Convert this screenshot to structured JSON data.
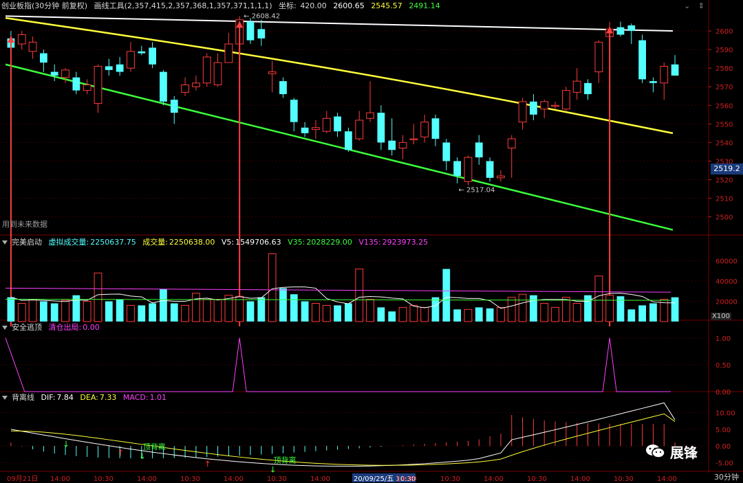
{
  "main_header": {
    "title": "创业板指(30分钟 前复权)",
    "tool": "画线工具(2,357,415,2,357,368,1,357,371,1,1,1)",
    "coord_label": "坐标:",
    "coord_value": "420.00",
    "value1": "2600.65",
    "value2": "2545.57",
    "value3": "2491.14"
  },
  "top_right_icons": [
    "chevron-down-icon",
    "up-down-icon"
  ],
  "future_label": "用到未来数据",
  "current_price": "2519.2",
  "high_label": "2608.42",
  "low_label": "2517.04",
  "volume_header": {
    "title": "完美启动",
    "v1_label": "虚拟成交量:",
    "v1_value": "2250637.75",
    "v2_label": "成交量:",
    "v2_value": "2250638.00",
    "v3_label": "V5:",
    "v3_value": "1549706.63",
    "v4_label": "V35:",
    "v4_value": "2028229.00",
    "v5_label": "V135:",
    "v5_value": "2923973.25"
  },
  "volume_multiplier": "X100",
  "safe_header": {
    "title": "安全逃顶",
    "v1_label": "清仓出局:",
    "v1_value": "0.00"
  },
  "macd_header": {
    "title": "背离线",
    "dif_label": "DIF:",
    "dif_value": "7.84",
    "dea_label": "DEA:",
    "dea_value": "7.33",
    "macd_label": "MACD:",
    "macd_value": "1.01"
  },
  "divergence_label": "顶背离",
  "timeframe": "30分钟",
  "watermark": "展锋",
  "colors": {
    "up": "#ff3c3c",
    "down": "#54ffff",
    "ma_white": "#ffffff",
    "ma_yellow": "#ffff3c",
    "ma_green": "#3cff3c",
    "magenta": "#ff40ff",
    "grid": "#7a0000",
    "axis_text": "#d02020"
  },
  "chart_data": [
    {
      "type": "candlestick",
      "title": "创业板指(30分钟 前复权)",
      "yticks": [
        2500,
        2510,
        2520,
        2530,
        2540,
        2550,
        2560,
        2570,
        2580,
        2590,
        2600
      ],
      "ylim": [
        2491,
        2610
      ],
      "x_ticks": [
        "09月21日",
        "14:00",
        "10:30",
        "14:00",
        "10:30",
        "14:00",
        "10:30",
        "14:00",
        "20/09/25/五 10:30",
        "14:00",
        "10:30",
        "14:00",
        "10:30",
        "14:00",
        "10:30",
        "14:00"
      ],
      "candles": [
        [
          2596,
          2591,
          2600,
          2588
        ],
        [
          2593,
          2598,
          2600,
          2590
        ],
        [
          2589,
          2594,
          2597,
          2585
        ],
        [
          2588,
          2583,
          2590,
          2578
        ],
        [
          2578,
          2576,
          2582,
          2573
        ],
        [
          2575,
          2579,
          2580,
          2572
        ],
        [
          2575,
          2568,
          2578,
          2566
        ],
        [
          2568,
          2571,
          2574,
          2566
        ],
        [
          2561,
          2581,
          2582,
          2556
        ],
        [
          2581,
          2579,
          2585,
          2576
        ],
        [
          2582,
          2578,
          2586,
          2576
        ],
        [
          2580,
          2589,
          2594,
          2578
        ],
        [
          2589,
          2588,
          2592,
          2587
        ],
        [
          2591,
          2582,
          2594,
          2580
        ],
        [
          2578,
          2562,
          2579,
          2560
        ],
        [
          2563,
          2556,
          2565,
          2550
        ],
        [
          2567,
          2571,
          2575,
          2565
        ],
        [
          2570,
          2572,
          2576,
          2568
        ],
        [
          2572,
          2586,
          2588,
          2570
        ],
        [
          2571,
          2583,
          2588,
          2570
        ],
        [
          2583,
          2593,
          2599,
          2583
        ],
        [
          2593,
          2606,
          2608,
          2592
        ],
        [
          2605,
          2595,
          2607,
          2593
        ],
        [
          2601,
          2596,
          2606,
          2592
        ],
        [
          2577,
          2578,
          2584,
          2567
        ],
        [
          2573,
          2566,
          2575,
          2564
        ],
        [
          2563,
          2551,
          2564,
          2546
        ],
        [
          2548,
          2545,
          2551,
          2543
        ],
        [
          2547,
          2548,
          2552,
          2542
        ],
        [
          2546,
          2553,
          2557,
          2545
        ],
        [
          2554,
          2546,
          2556,
          2543
        ],
        [
          2546,
          2536,
          2548,
          2535
        ],
        [
          2542,
          2552,
          2557,
          2541
        ],
        [
          2553,
          2556,
          2573,
          2551
        ],
        [
          2556,
          2540,
          2560,
          2536
        ],
        [
          2541,
          2536,
          2553,
          2533
        ],
        [
          2537,
          2540,
          2544,
          2531
        ],
        [
          2542,
          2542,
          2550,
          2539
        ],
        [
          2543,
          2551,
          2555,
          2540
        ],
        [
          2553,
          2542,
          2555,
          2538
        ],
        [
          2540,
          2530,
          2542,
          2525
        ],
        [
          2530,
          2522,
          2532,
          2518
        ],
        [
          2519,
          2532,
          2533,
          2517
        ],
        [
          2540,
          2532,
          2544,
          2528
        ],
        [
          2530,
          2521,
          2532,
          2519
        ],
        [
          2521,
          2522,
          2525,
          2519
        ],
        [
          2537,
          2542,
          2544,
          2521
        ],
        [
          2551,
          2562,
          2564,
          2547
        ],
        [
          2562,
          2555,
          2566,
          2552
        ],
        [
          2558,
          2562,
          2563,
          2553
        ],
        [
          2560,
          2560,
          2562,
          2558
        ],
        [
          2558,
          2568,
          2570,
          2557
        ],
        [
          2567,
          2573,
          2580,
          2563
        ],
        [
          2572,
          2566,
          2574,
          2563
        ],
        [
          2578,
          2594,
          2595,
          2572
        ],
        [
          2597,
          2601,
          2605,
          2595
        ],
        [
          2602,
          2598,
          2605,
          2597
        ],
        [
          2603,
          2600,
          2604,
          2593
        ],
        [
          2595,
          2574,
          2598,
          2572
        ],
        [
          2573,
          2572,
          2575,
          2567
        ],
        [
          2572,
          2581,
          2583,
          2563
        ],
        [
          2582,
          2576,
          2587,
          2576
        ]
      ],
      "ma_white_start": 2608,
      "ma_white_end": 2600,
      "ma_yellow_start": 2607,
      "ma_yellow_end": 2545,
      "channel_green_start": 2582,
      "channel_green_end": 2493,
      "arrow_candles": [
        0,
        21,
        55
      ]
    },
    {
      "type": "bar",
      "title": "完美启动",
      "yticks": [
        20000,
        40000,
        60000
      ],
      "ylim": [
        0,
        72000
      ],
      "volumes": [
        24000,
        18000,
        22000,
        20000,
        18000,
        21000,
        26000,
        20000,
        48000,
        20000,
        22000,
        16000,
        16000,
        18000,
        32000,
        18000,
        16000,
        28000,
        22000,
        22000,
        26000,
        25000,
        20000,
        24000,
        67000,
        33000,
        27000,
        20000,
        18000,
        16000,
        16000,
        18000,
        52000,
        22000,
        14000,
        10000,
        14000,
        16000,
        14000,
        24000,
        52000,
        12000,
        12000,
        14000,
        13000,
        14000,
        24000,
        27000,
        26000,
        18000,
        14000,
        24000,
        18000,
        26000,
        45000,
        26000,
        25000,
        12000,
        16000,
        18000,
        22000,
        24000
      ]
    },
    {
      "type": "line",
      "title": "安全逃顶",
      "yticks": [
        0.0,
        0.5,
        1.0
      ],
      "ylim": [
        0,
        1.1
      ],
      "spikes": [
        0,
        21,
        55
      ]
    },
    {
      "type": "line",
      "title": "背离线",
      "yticks": [
        -5.0,
        0.0,
        5.0,
        10.0
      ],
      "ylim": [
        -8,
        13
      ],
      "dif_start": 5,
      "dif_end": 7.84,
      "dea_start": 4,
      "dea_end": 7.33
    }
  ]
}
